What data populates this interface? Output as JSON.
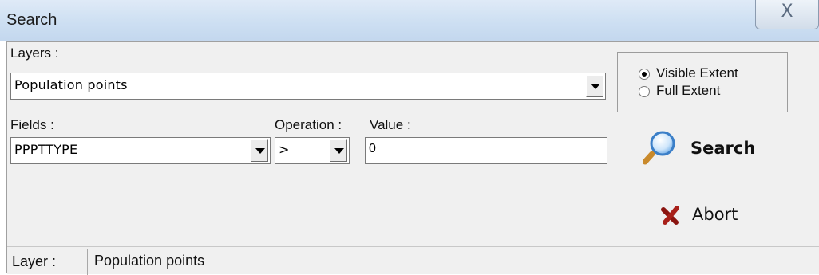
{
  "window": {
    "title": "Search",
    "close_glyph": "X"
  },
  "layers": {
    "label": "Layers :",
    "selected": "Population points"
  },
  "fields": {
    "label": "Fields :",
    "selected": "PPPTTYPE"
  },
  "operation": {
    "label": "Operation :",
    "selected": ">"
  },
  "value": {
    "label": "Value :",
    "text": "0"
  },
  "extent": {
    "options": [
      {
        "label": "Visible Extent",
        "selected": true
      },
      {
        "label": "Full Extent",
        "selected": false
      }
    ]
  },
  "actions": {
    "search_label": "Search",
    "search_icon": "magnifier-icon",
    "abort_label": "Abort",
    "abort_icon": "red-x-icon"
  },
  "status": {
    "label": "Layer :",
    "value": "Population points"
  }
}
